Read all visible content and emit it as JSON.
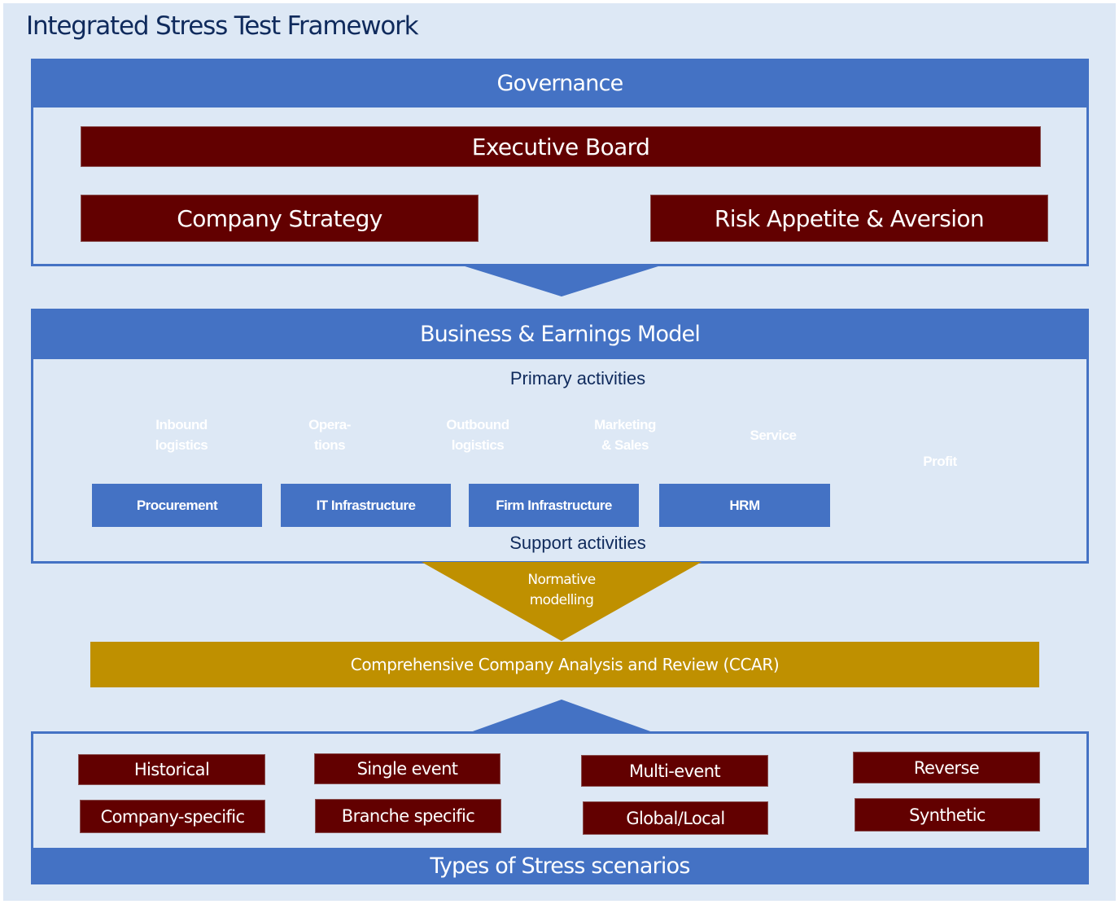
{
  "title": "Integrated Stress Test Framework",
  "colors": {
    "background": "#dde8f5",
    "blue": "#4472c4",
    "maroon": "#620000",
    "gold": "#bf9000",
    "green": "#548235",
    "title_text": "#0f2a5c"
  },
  "governance": {
    "header": "Governance",
    "executive_board": "Executive Board",
    "company_strategy": "Company Strategy",
    "risk_appetite": "Risk Appetite & Aversion",
    "connector": "bidirectional-arrow"
  },
  "business_model": {
    "header": "Business & Earnings Model",
    "primary_label": "Primary activities",
    "primary_activities": [
      {
        "label": "Inbound\nlogistics"
      },
      {
        "label": "Opera-\ntions"
      },
      {
        "label": "Outbound\nlogistics"
      },
      {
        "label": "Marketing\n& Sales"
      },
      {
        "label": "Service"
      }
    ],
    "profit": "Profit",
    "support_label": "Support activities",
    "support_activities": [
      {
        "label": "Procurement"
      },
      {
        "label": "IT Infrastructure"
      },
      {
        "label": "Firm Infrastructure"
      },
      {
        "label": "HRM"
      }
    ]
  },
  "normative": {
    "label": "Normative\nmodelling"
  },
  "ccar": {
    "label": "Comprehensive Company Analysis and Review (CCAR)"
  },
  "scenarios": {
    "footer": "Types of Stress scenarios",
    "items": [
      {
        "label": "Historical"
      },
      {
        "label": "Single event"
      },
      {
        "label": "Multi-event"
      },
      {
        "label": "Reverse"
      },
      {
        "label": "Company-specific"
      },
      {
        "label": "Branche specific"
      },
      {
        "label": "Global/Local"
      },
      {
        "label": "Synthetic"
      }
    ]
  }
}
